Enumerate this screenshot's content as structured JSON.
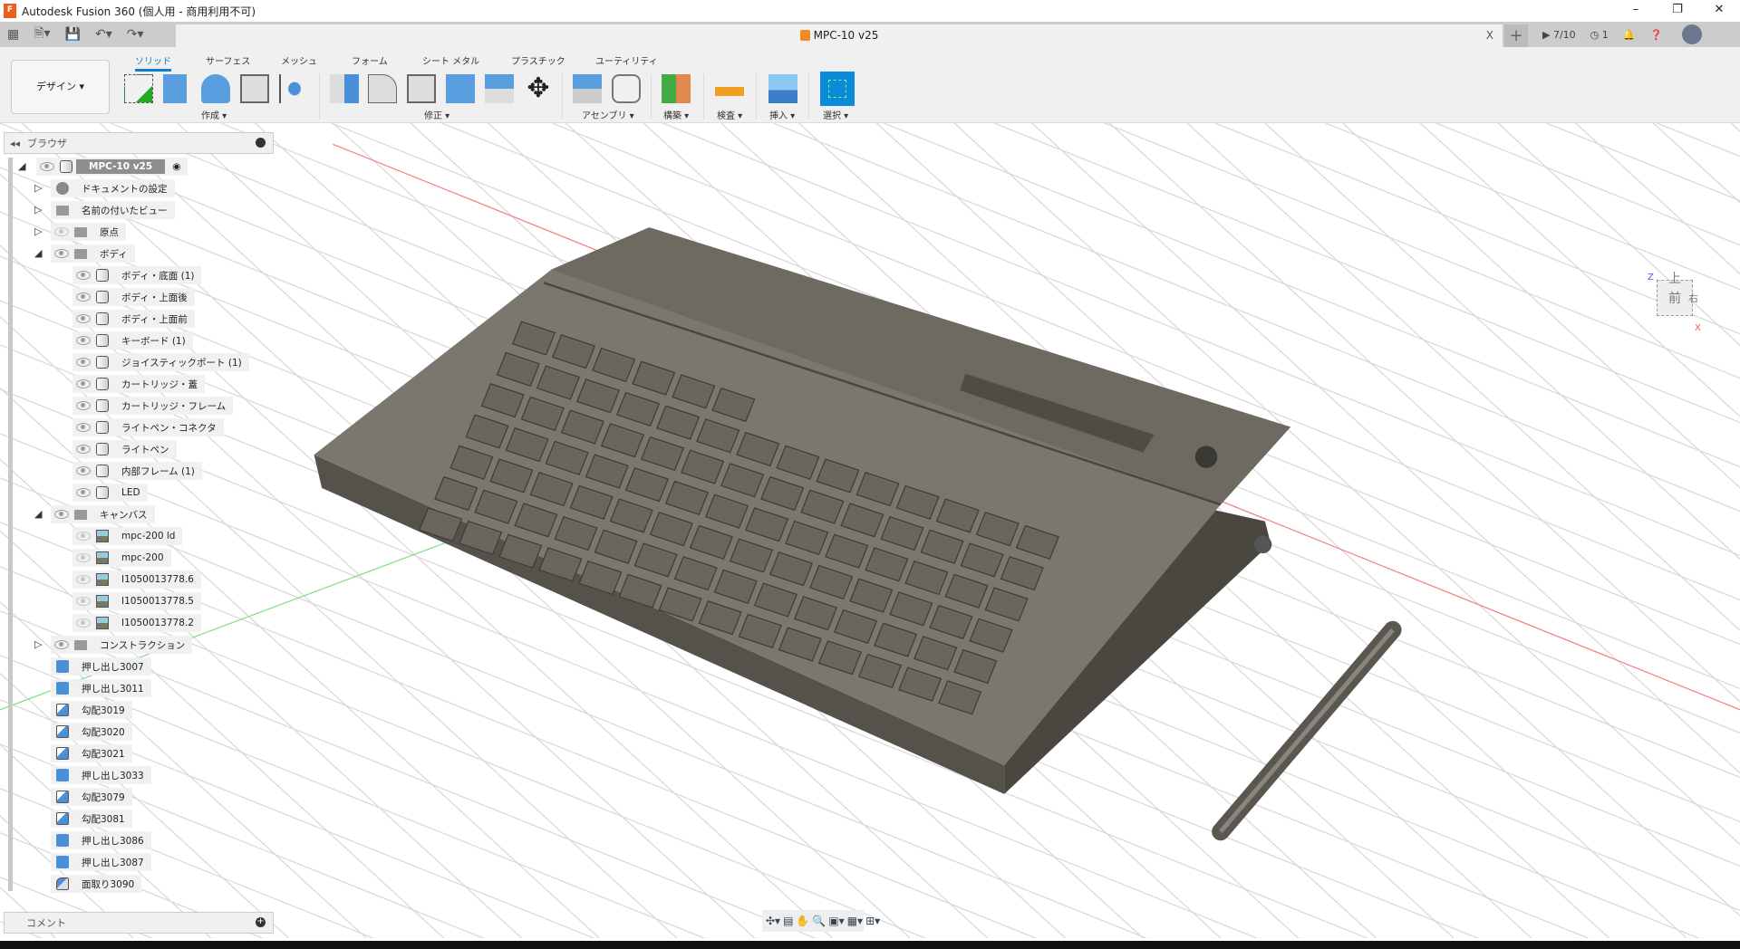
{
  "window": {
    "title": "Autodesk Fusion 360 (個人用 - 商用利用不可)",
    "app_logo": "F"
  },
  "doc_tab": {
    "title": "MPC-10 v25",
    "close": "X"
  },
  "status": {
    "jobs": "7/10",
    "clock_count": "1"
  },
  "toolbar": {
    "workspace": "デザイン ▾",
    "tabs": [
      "ソリッド",
      "サーフェス",
      "メッシュ",
      "フォーム",
      "シート メタル",
      "プラスチック",
      "ユーティリティ"
    ],
    "groups": [
      "作成 ▾",
      "修正 ▾",
      "アセンブリ ▾",
      "構築 ▾",
      "検査 ▾",
      "挿入 ▾",
      "選択 ▾"
    ]
  },
  "browser": {
    "title": "ブラウザ",
    "root": "MPC-10 v25",
    "items": [
      {
        "label": "ドキュメントの設定",
        "level": 1,
        "icon": "gear"
      },
      {
        "label": "名前の付いたビュー",
        "level": 1,
        "icon": "folder"
      },
      {
        "label": "原点",
        "level": 1,
        "icon": "folder",
        "eye": "off"
      },
      {
        "label": "ボディ",
        "level": 1,
        "icon": "folder",
        "eye": "on",
        "open": true
      },
      {
        "label": "ボディ・底面 (1)",
        "level": 2,
        "icon": "body",
        "eye": "on"
      },
      {
        "label": "ボディ・上面後",
        "level": 2,
        "icon": "body",
        "eye": "on"
      },
      {
        "label": "ボディ・上面前",
        "level": 2,
        "icon": "body",
        "eye": "on"
      },
      {
        "label": "キーボード (1)",
        "level": 2,
        "icon": "body",
        "eye": "on"
      },
      {
        "label": "ジョイスティックポート (1)",
        "level": 2,
        "icon": "body",
        "eye": "on"
      },
      {
        "label": "カートリッジ・蓋",
        "level": 2,
        "icon": "body",
        "eye": "on"
      },
      {
        "label": "カートリッジ・フレーム",
        "level": 2,
        "icon": "body",
        "eye": "on"
      },
      {
        "label": "ライトペン・コネクタ",
        "level": 2,
        "icon": "body",
        "eye": "on"
      },
      {
        "label": "ライトペン",
        "level": 2,
        "icon": "body",
        "eye": "on"
      },
      {
        "label": "内部フレーム (1)",
        "level": 2,
        "icon": "body",
        "eye": "on"
      },
      {
        "label": "LED",
        "level": 2,
        "icon": "body",
        "eye": "on"
      },
      {
        "label": "キャンバス",
        "level": 1,
        "icon": "folder",
        "eye": "on",
        "open": true
      },
      {
        "label": "mpc-200 ld",
        "level": 2,
        "icon": "canvas",
        "eye": "off"
      },
      {
        "label": "mpc-200",
        "level": 2,
        "icon": "canvas",
        "eye": "off"
      },
      {
        "label": "I1050013778.6",
        "level": 2,
        "icon": "canvas",
        "eye": "off"
      },
      {
        "label": "I1050013778.5",
        "level": 2,
        "icon": "canvas",
        "eye": "off"
      },
      {
        "label": "I1050013778.2",
        "level": 2,
        "icon": "canvas",
        "eye": "off"
      },
      {
        "label": "コンストラクション",
        "level": 1,
        "icon": "folder",
        "eye": "on"
      },
      {
        "label": "押し出し3007",
        "level": 0,
        "icon": "ext"
      },
      {
        "label": "押し出し3011",
        "level": 0,
        "icon": "ext"
      },
      {
        "label": "勾配3019",
        "level": 0,
        "icon": "draft"
      },
      {
        "label": "勾配3020",
        "level": 0,
        "icon": "draft"
      },
      {
        "label": "勾配3021",
        "level": 0,
        "icon": "draft"
      },
      {
        "label": "押し出し3033",
        "level": 0,
        "icon": "ext"
      },
      {
        "label": "勾配3079",
        "level": 0,
        "icon": "draft"
      },
      {
        "label": "勾配3081",
        "level": 0,
        "icon": "draft"
      },
      {
        "label": "押し出し3086",
        "level": 0,
        "icon": "ext"
      },
      {
        "label": "押し出し3087",
        "level": 0,
        "icon": "ext"
      },
      {
        "label": "面取り3090",
        "level": 0,
        "icon": "fillet"
      }
    ]
  },
  "comments": {
    "title": "コメント"
  },
  "viewcube": {
    "top": "上",
    "front": "前",
    "right": "右",
    "axis_z": "Z",
    "axis_x": "X"
  },
  "colors": {
    "accent": "#0a7fd0",
    "model": "#6e6a62",
    "axis_x": "#e05050",
    "axis_y": "#60d060"
  }
}
